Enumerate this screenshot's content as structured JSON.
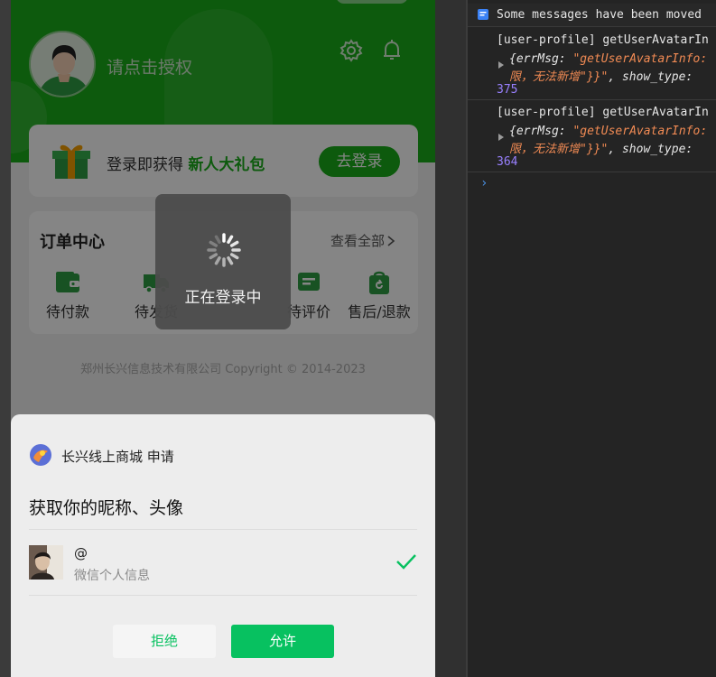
{
  "mini_program": {
    "profile": {
      "login_hint": "请点击授权"
    },
    "gift_banner": {
      "text": "登录即获得 ",
      "highlight": "新人大礼包",
      "button": "去登录"
    },
    "orders": {
      "title": "订单中心",
      "view_all": "查看全部",
      "items": [
        {
          "label": "待付款",
          "icon": "wallet-icon"
        },
        {
          "label": "待发货",
          "icon": "truck-icon"
        },
        {
          "label": "待评价",
          "icon": "review-icon"
        },
        {
          "label": "售后/退款",
          "icon": "refund-bag-icon"
        }
      ]
    },
    "copyright": "郑州长兴信息技术有限公司 Copyright © 2014-2023",
    "toast": {
      "text": "正在登录中",
      "icon": "loading-spinner-icon"
    },
    "auth_sheet": {
      "app_name": "长兴线上商城  申请",
      "title": "获取你的昵称、头像",
      "user_name": "@",
      "user_sub": "微信个人信息",
      "reject": "拒绝",
      "allow": "允许"
    },
    "colors": {
      "brand_green": "#1aad19",
      "wechat_green": "#07c160"
    }
  },
  "console": {
    "banner": "Some messages have been moved",
    "entries": [
      {
        "source": "[user-profile] getUserAvatarIn",
        "detail_key": "{errMsg: ",
        "detail_str": "\"getUserAvatarInfo:",
        "cont_str": "限，无法新增\"}}\"",
        "cont_tail": ", show_type:",
        "line": "375"
      },
      {
        "source": "[user-profile] getUserAvatarIn",
        "detail_key": "{errMsg: ",
        "detail_str": "\"getUserAvatarInfo:",
        "cont_str": "限，无法新增\"}}\"",
        "cont_tail": ", show_type:",
        "line": "364"
      }
    ],
    "prompt": "›"
  }
}
